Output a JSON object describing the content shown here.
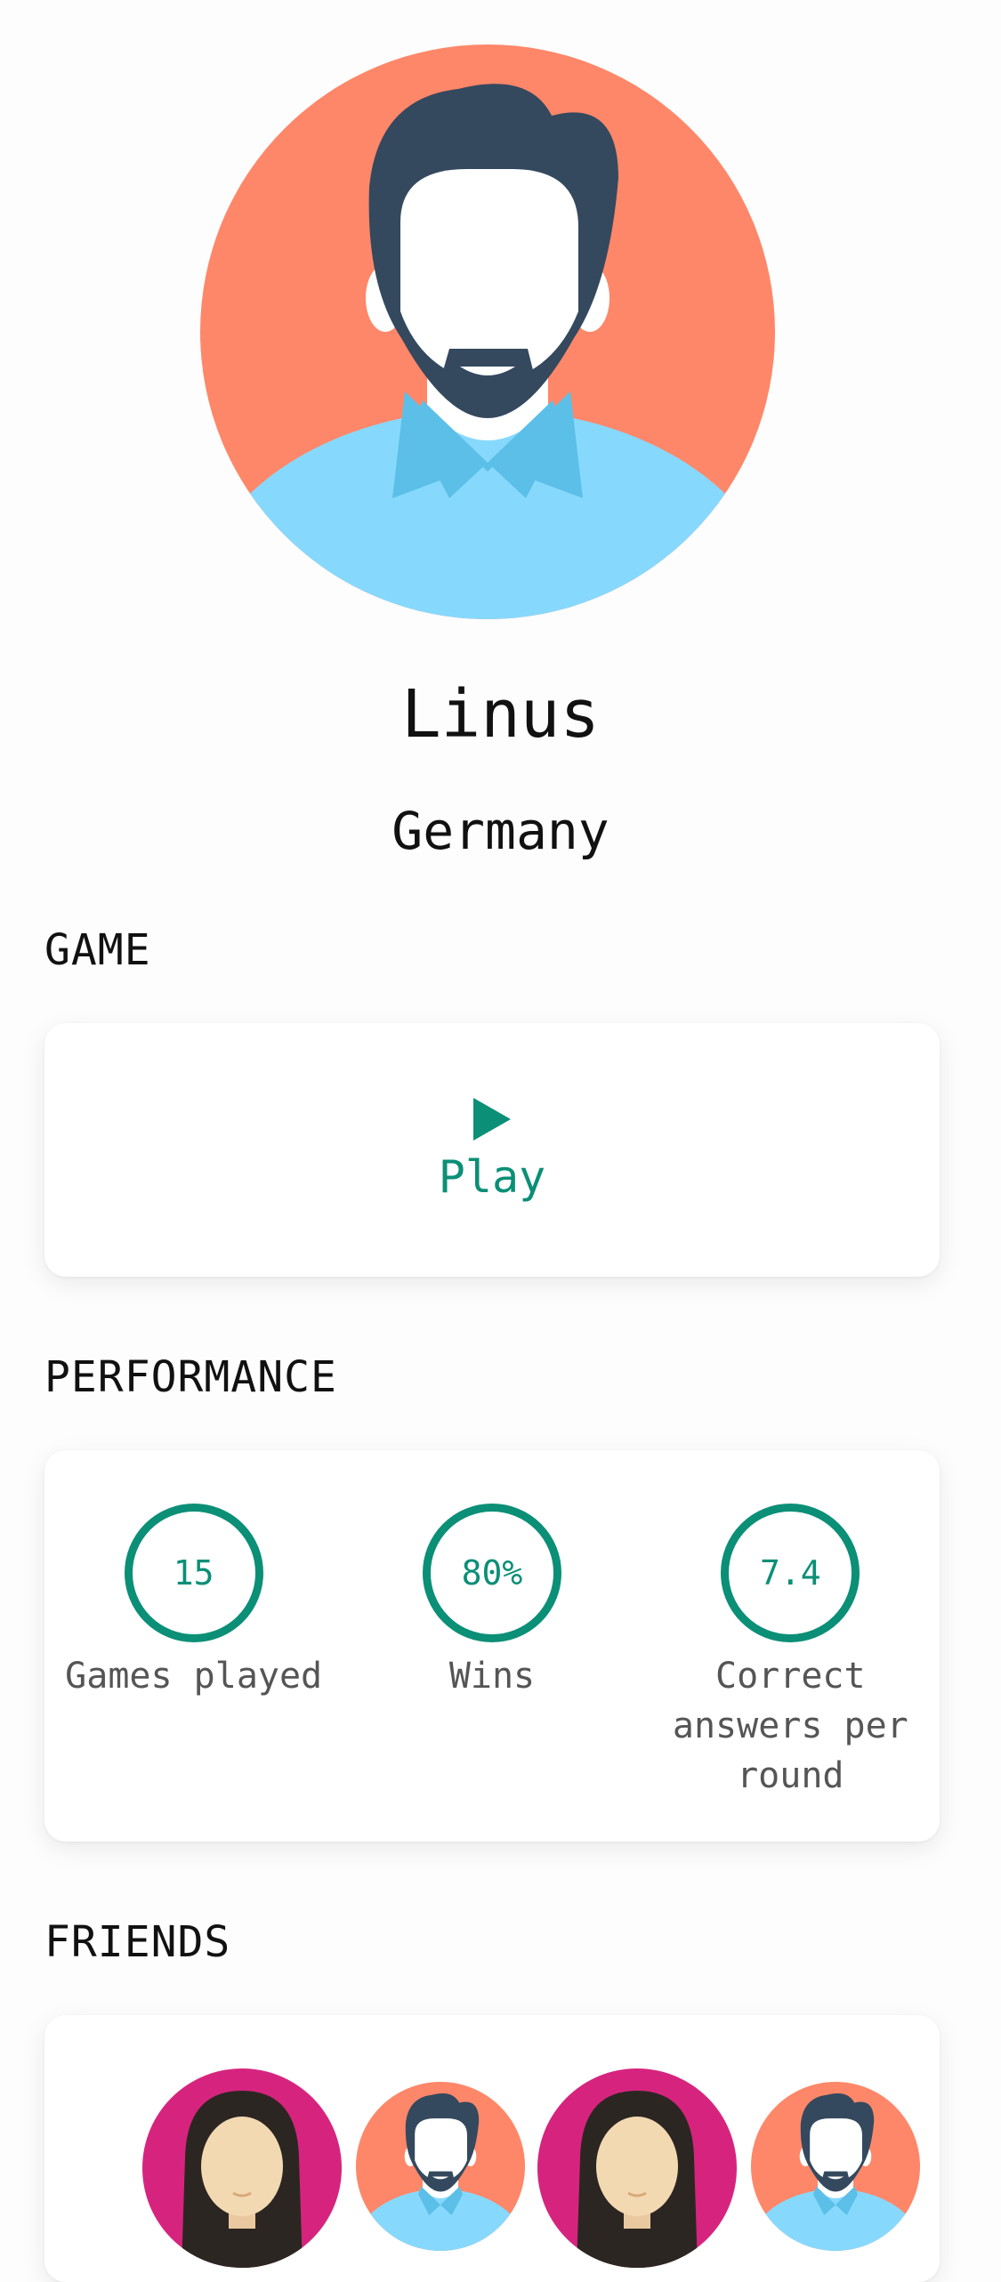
{
  "profile": {
    "name": "Linus",
    "country": "Germany",
    "avatar": "male-avatar-icon"
  },
  "sections": {
    "game": "GAME",
    "performance": "PERFORMANCE",
    "friends": "FRIENDS"
  },
  "game": {
    "play_label": "Play",
    "play_icon": "play-icon"
  },
  "performance": {
    "stats": [
      {
        "value": "15",
        "label": "Games played"
      },
      {
        "value": "80%",
        "label": "Wins"
      },
      {
        "value": "7.4",
        "label": "Correct answers per round"
      }
    ]
  },
  "friends": {
    "avatars": [
      "female-avatar-icon",
      "male-avatar-icon",
      "female-avatar-icon",
      "male-avatar-icon"
    ]
  },
  "colors": {
    "accent": "#0b8f77",
    "avatar_bg_male": "#fe8769",
    "avatar_bg_female": "#d6247e",
    "shirt": "#86d9fd",
    "hair": "#34495e"
  }
}
